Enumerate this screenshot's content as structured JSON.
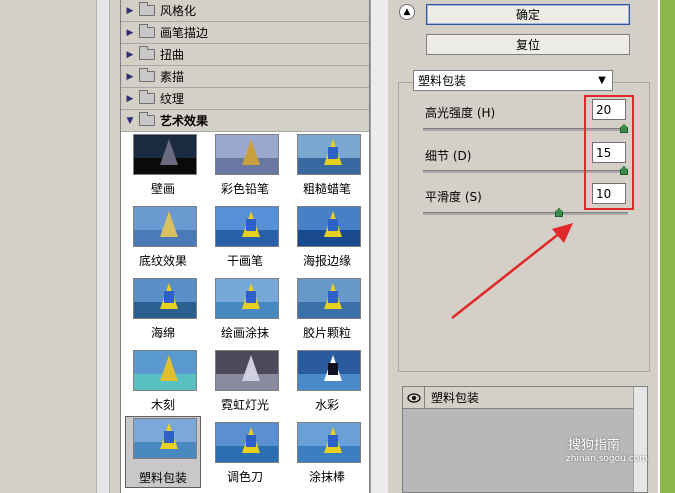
{
  "categories": [
    {
      "label": "风格化",
      "open": false
    },
    {
      "label": "画笔描边",
      "open": false
    },
    {
      "label": "扭曲",
      "open": false
    },
    {
      "label": "素描",
      "open": false
    },
    {
      "label": "纹理",
      "open": false
    },
    {
      "label": "艺术效果",
      "open": true
    }
  ],
  "thumbnails": [
    {
      "label": "壁画"
    },
    {
      "label": "彩色铅笔"
    },
    {
      "label": "粗糙蜡笔"
    },
    {
      "label": "底纹效果"
    },
    {
      "label": "干画笔"
    },
    {
      "label": "海报边缘"
    },
    {
      "label": "海绵"
    },
    {
      "label": "绘画涂抹"
    },
    {
      "label": "胶片颗粒"
    },
    {
      "label": "木刻"
    },
    {
      "label": "霓虹灯光"
    },
    {
      "label": "水彩"
    },
    {
      "label": "塑料包装",
      "selected": true
    },
    {
      "label": "调色刀"
    },
    {
      "label": "涂抹棒"
    }
  ],
  "buttons": {
    "ok": "确定",
    "reset": "复位"
  },
  "filter": {
    "selected": "塑料包装"
  },
  "params": [
    {
      "label": "高光强度 (H)",
      "value": "20",
      "slider_fraction": 1.0
    },
    {
      "label": "细节 (D)",
      "value": "15",
      "slider_fraction": 1.0
    },
    {
      "label": "平滑度 (S)",
      "value": "10",
      "slider_fraction": 0.67
    }
  ],
  "layers": [
    {
      "name": "塑料包装"
    }
  ],
  "watermark": {
    "main": "搜狗指南",
    "sub": "zhinan.sogou.com"
  },
  "colors": {
    "highlight_box": "#e02828",
    "panel_bg": "#d4d0c8",
    "accent_green": "#8ab84a"
  }
}
